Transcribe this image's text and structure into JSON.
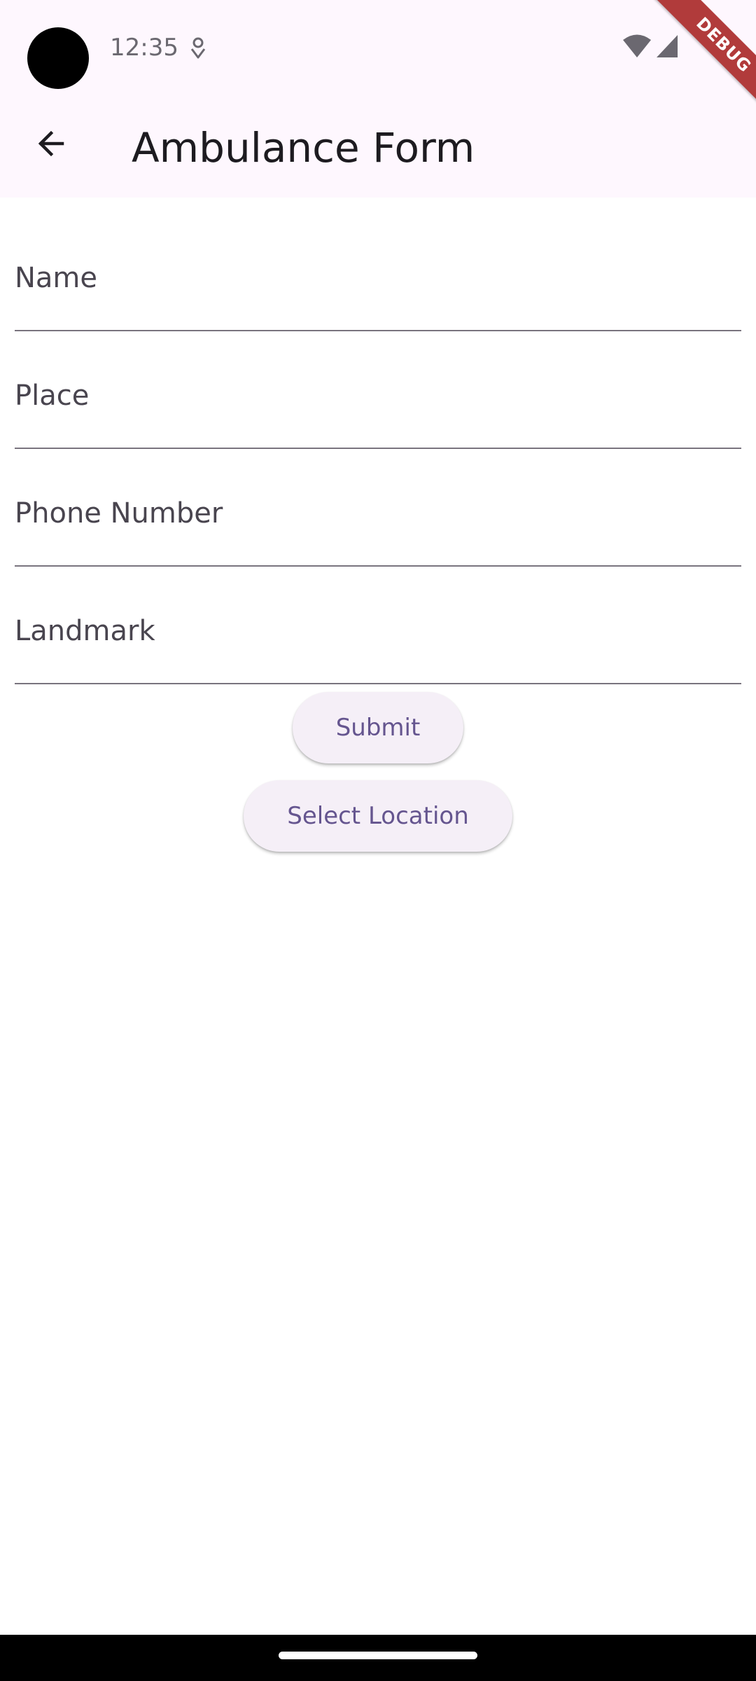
{
  "status_bar": {
    "time": "12:35",
    "notification_icon": "location-pin-icon",
    "wifi_icon": "wifi-icon",
    "signal_icon": "cell-signal-icon"
  },
  "debug_banner": {
    "label": "DEBUG",
    "color": "#b13b3b"
  },
  "app_bar": {
    "back_icon": "arrow-back-icon",
    "title": "Ambulance Form",
    "background": "#fef7fe"
  },
  "form": {
    "fields": [
      {
        "placeholder": "Name",
        "value": ""
      },
      {
        "placeholder": "Place",
        "value": ""
      },
      {
        "placeholder": "Phone Number",
        "value": ""
      },
      {
        "placeholder": "Landmark",
        "value": ""
      }
    ]
  },
  "actions": {
    "submit_label": "Submit",
    "select_location_label": "Select Location",
    "button_text_color": "#65558f",
    "button_background": "#f5eff7"
  }
}
